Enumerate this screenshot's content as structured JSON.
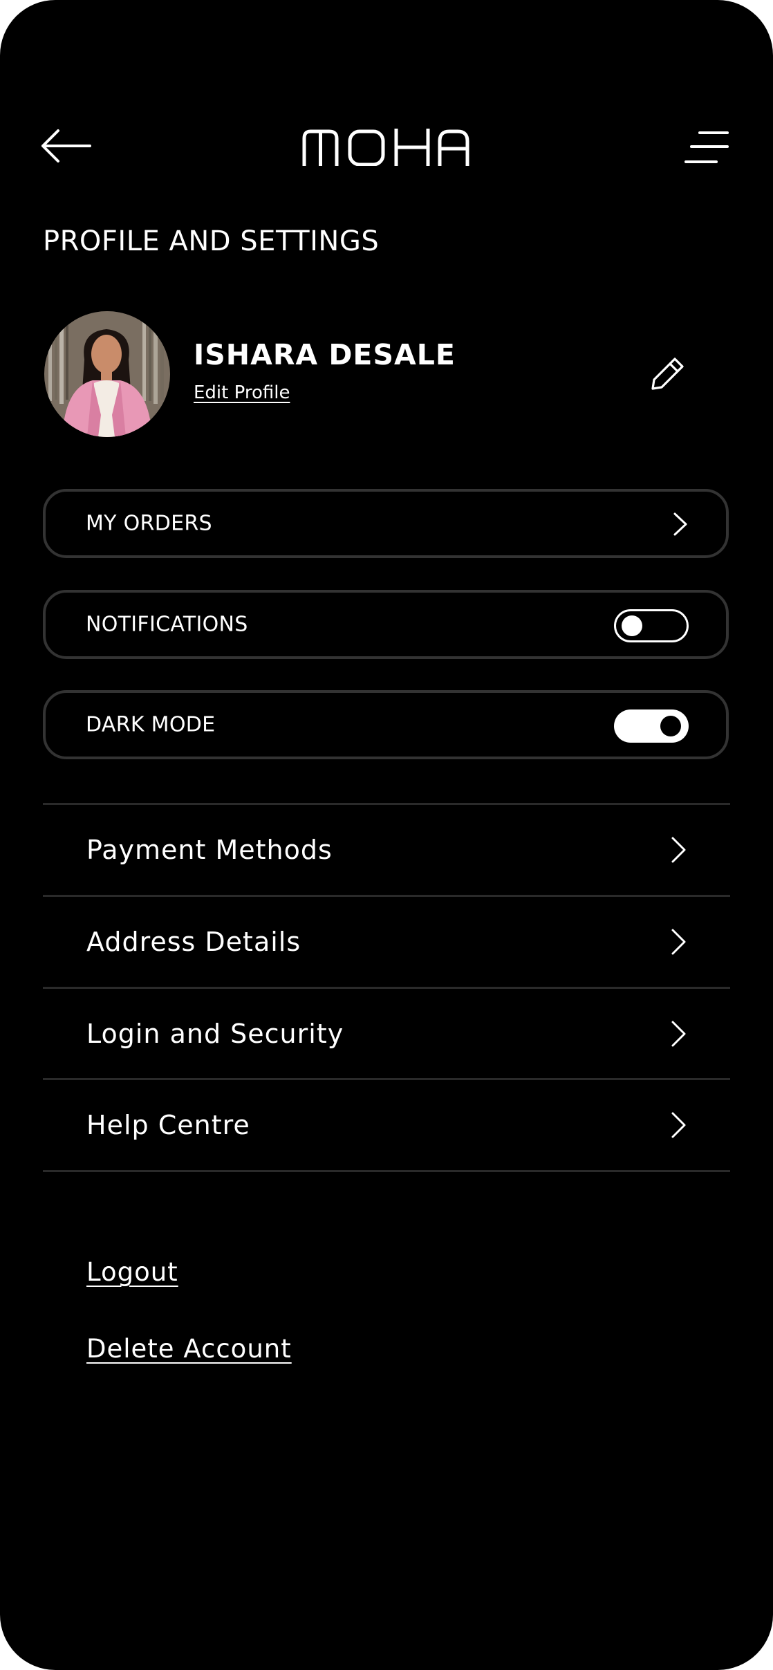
{
  "header": {
    "logo_text": "MOHA",
    "back_icon": "arrow-left-icon",
    "menu_icon": "menu-lines-icon"
  },
  "page": {
    "title": "PROFILE AND SETTINGS"
  },
  "profile": {
    "name": "ISHARA DESALE",
    "edit_link": "Edit Profile",
    "edit_icon": "pencil-icon",
    "avatar_colors": {
      "jacket": "#e898b6",
      "top": "#f3ece4",
      "skin": "#c98c6a",
      "hair": "#1c1310",
      "background": "#8a7d6e"
    }
  },
  "cards": {
    "orders": {
      "label": "MY ORDERS"
    },
    "notifications": {
      "label": "NOTIFICATIONS",
      "enabled": false
    },
    "dark_mode": {
      "label": "DARK MODE",
      "enabled": true
    }
  },
  "menu": {
    "items": [
      {
        "label": "Payment Methods"
      },
      {
        "label": "Address Details"
      },
      {
        "label": "Login and Security"
      },
      {
        "label": "Help Centre"
      }
    ]
  },
  "account": {
    "logout": "Logout",
    "delete": "Delete Account"
  },
  "colors": {
    "background": "#000000",
    "text": "#ffffff",
    "card_border": "#333333",
    "divider": "#2a2a2a"
  }
}
